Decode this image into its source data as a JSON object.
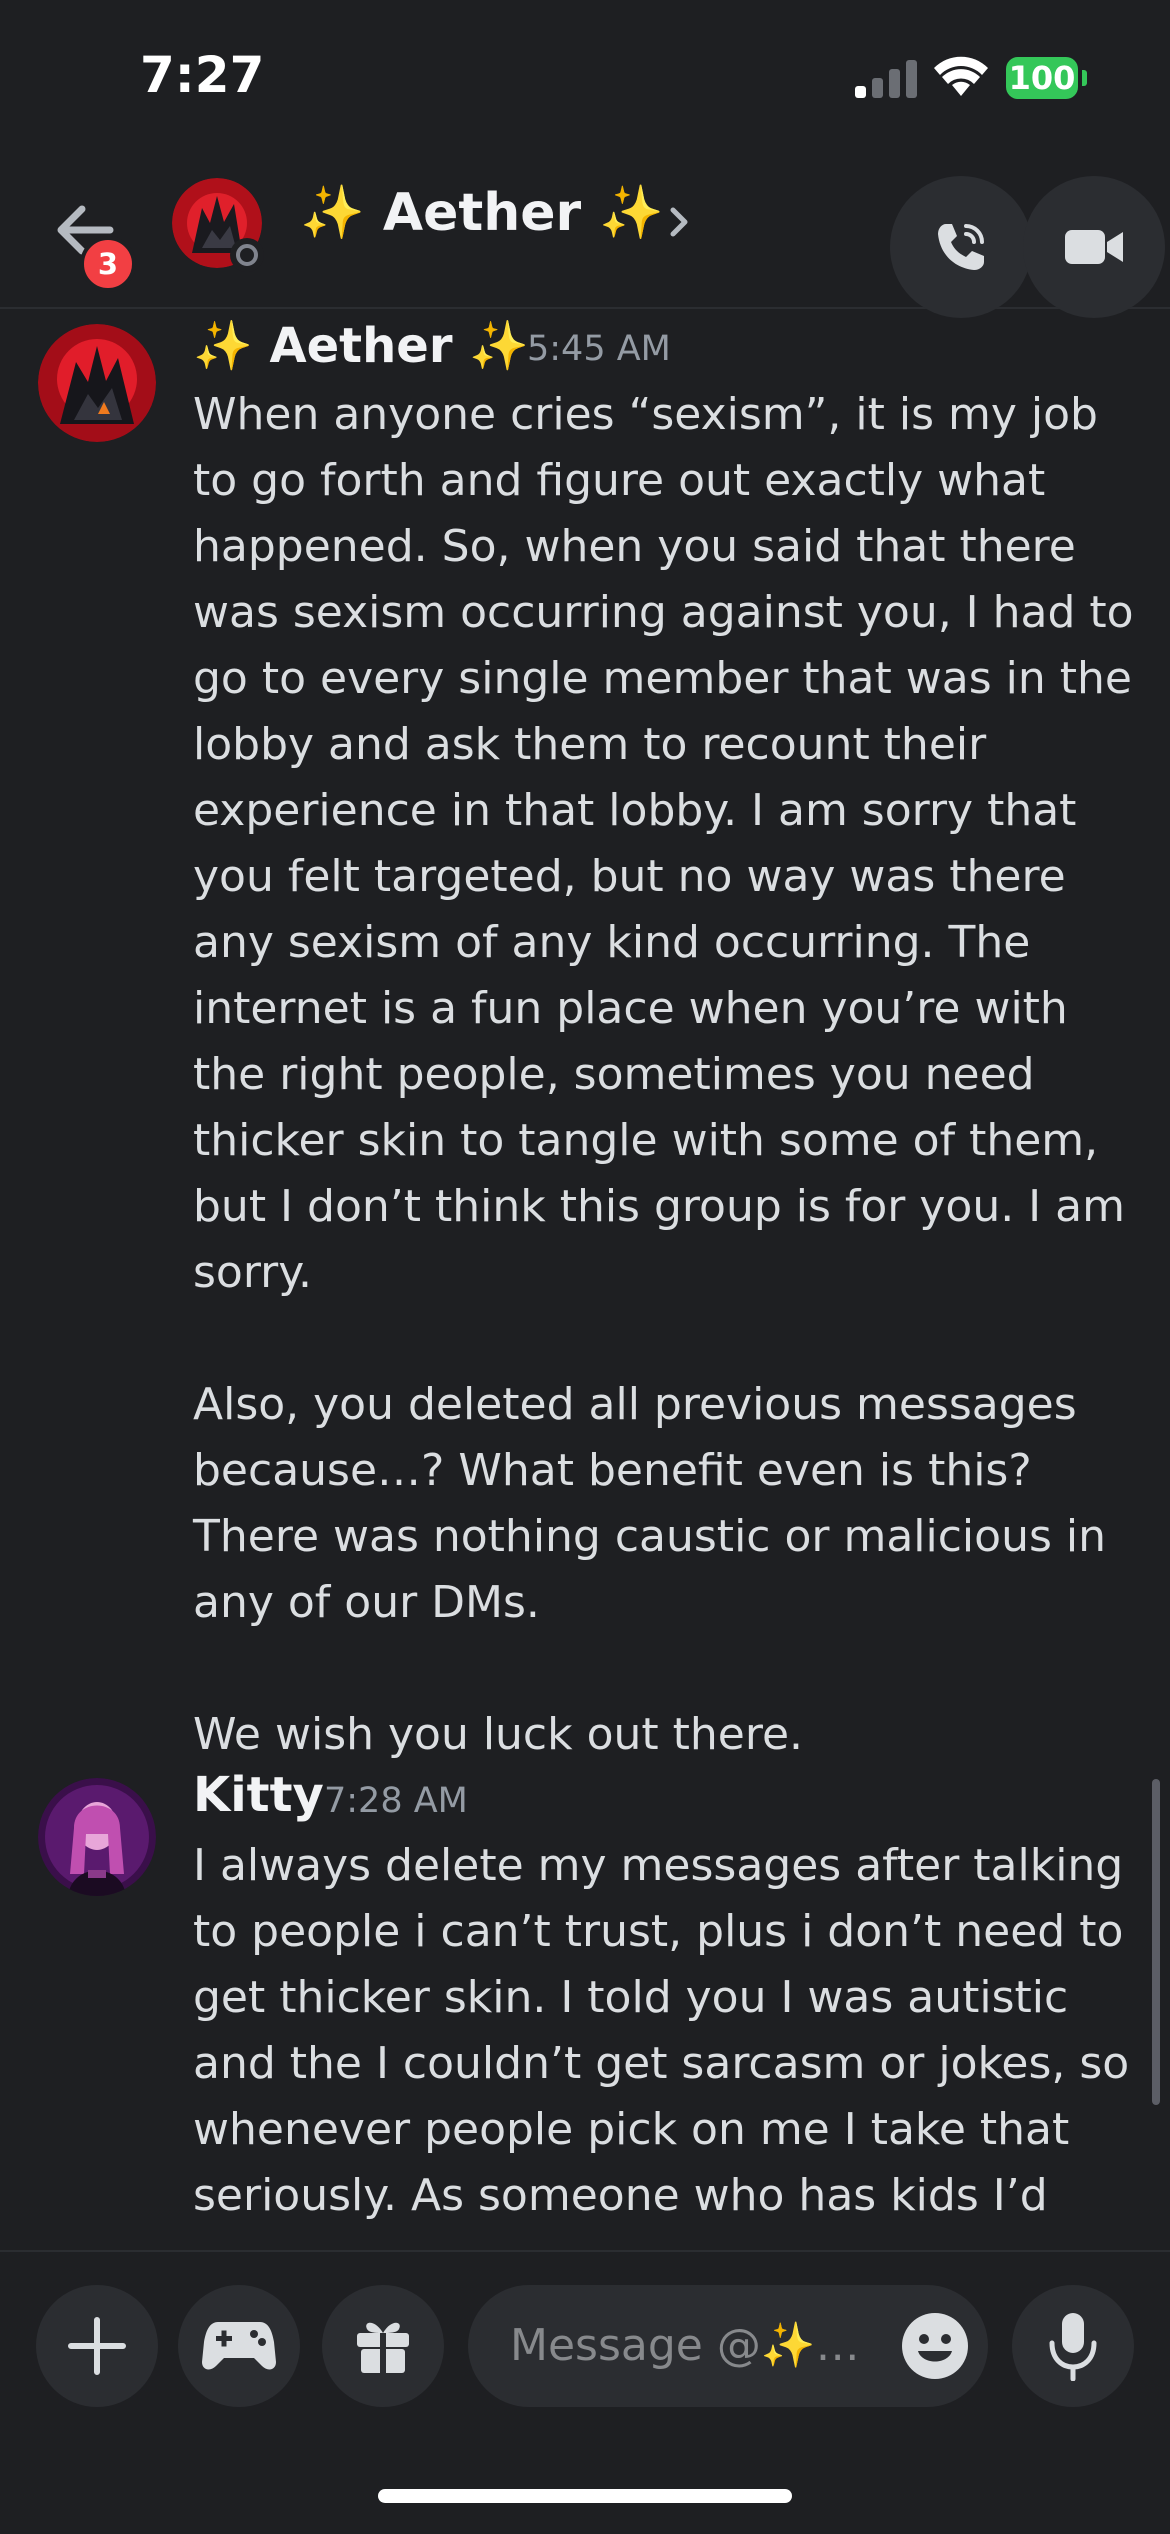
{
  "status_bar": {
    "time": "7:27",
    "battery": "100"
  },
  "header": {
    "badge_count": "3",
    "title": "✨ Aether ✨",
    "chevron": "›"
  },
  "messages": [
    {
      "author": "✨ Aether ✨",
      "time": "5:45 AM",
      "text": "When anyone cries “sexism”, it is my job to go forth and figure out exactly what happened. So, when you said that there was sexism occurring against you, I had to go to every single member that was in the lobby and ask them to recount their experience in that lobby. I am sorry that you felt targeted, but no way was there any sexism of any kind occurring. The internet is a fun place when you’re with the right people, sometimes you need thicker skin to tangle with some of them, but I don’t think this group is for you.  I am sorry.\n\nAlso, you deleted all previous messages because…? What benefit even is this? There was nothing caustic or malicious in any of our DMs.\n\nWe wish you luck out there."
    },
    {
      "author": "Kitty",
      "time": "7:28 AM",
      "text": "I always delete my messages  after talking to people i can’t trust, plus i don’t need to get thicker skin. I told you I was autistic and the I couldn’t get sarcasm or jokes, so whenever people pick on me I take that seriously. As someone who has kids I’d"
    }
  ],
  "composer": {
    "placeholder": "Message @✨…"
  },
  "icons": {
    "back": "arrow-left-icon",
    "call": "phone-icon",
    "video": "video-camera-icon",
    "add": "plus-icon",
    "games": "gamepad-icon",
    "gift": "gift-icon",
    "emoji": "smiley-icon",
    "voice": "microphone-icon"
  },
  "colors": {
    "background": "#1e1f22",
    "badge": "#f23f43",
    "battery": "#34c759",
    "timestamp": "#949ba4",
    "button_bg": "#2b2d31"
  }
}
